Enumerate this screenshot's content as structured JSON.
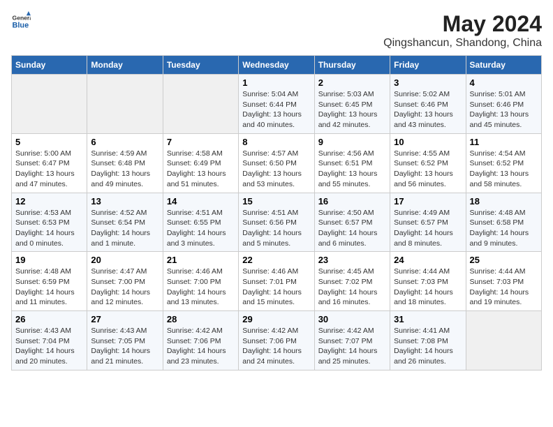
{
  "header": {
    "logo_general": "General",
    "logo_blue": "Blue",
    "title": "May 2024",
    "subtitle": "Qingshancun, Shandong, China"
  },
  "calendar": {
    "days_of_week": [
      "Sunday",
      "Monday",
      "Tuesday",
      "Wednesday",
      "Thursday",
      "Friday",
      "Saturday"
    ],
    "weeks": [
      [
        {
          "day": "",
          "info": ""
        },
        {
          "day": "",
          "info": ""
        },
        {
          "day": "",
          "info": ""
        },
        {
          "day": "1",
          "info": "Sunrise: 5:04 AM\nSunset: 6:44 PM\nDaylight: 13 hours\nand 40 minutes."
        },
        {
          "day": "2",
          "info": "Sunrise: 5:03 AM\nSunset: 6:45 PM\nDaylight: 13 hours\nand 42 minutes."
        },
        {
          "day": "3",
          "info": "Sunrise: 5:02 AM\nSunset: 6:46 PM\nDaylight: 13 hours\nand 43 minutes."
        },
        {
          "day": "4",
          "info": "Sunrise: 5:01 AM\nSunset: 6:46 PM\nDaylight: 13 hours\nand 45 minutes."
        }
      ],
      [
        {
          "day": "5",
          "info": "Sunrise: 5:00 AM\nSunset: 6:47 PM\nDaylight: 13 hours\nand 47 minutes."
        },
        {
          "day": "6",
          "info": "Sunrise: 4:59 AM\nSunset: 6:48 PM\nDaylight: 13 hours\nand 49 minutes."
        },
        {
          "day": "7",
          "info": "Sunrise: 4:58 AM\nSunset: 6:49 PM\nDaylight: 13 hours\nand 51 minutes."
        },
        {
          "day": "8",
          "info": "Sunrise: 4:57 AM\nSunset: 6:50 PM\nDaylight: 13 hours\nand 53 minutes."
        },
        {
          "day": "9",
          "info": "Sunrise: 4:56 AM\nSunset: 6:51 PM\nDaylight: 13 hours\nand 55 minutes."
        },
        {
          "day": "10",
          "info": "Sunrise: 4:55 AM\nSunset: 6:52 PM\nDaylight: 13 hours\nand 56 minutes."
        },
        {
          "day": "11",
          "info": "Sunrise: 4:54 AM\nSunset: 6:52 PM\nDaylight: 13 hours\nand 58 minutes."
        }
      ],
      [
        {
          "day": "12",
          "info": "Sunrise: 4:53 AM\nSunset: 6:53 PM\nDaylight: 14 hours\nand 0 minutes."
        },
        {
          "day": "13",
          "info": "Sunrise: 4:52 AM\nSunset: 6:54 PM\nDaylight: 14 hours\nand 1 minute."
        },
        {
          "day": "14",
          "info": "Sunrise: 4:51 AM\nSunset: 6:55 PM\nDaylight: 14 hours\nand 3 minutes."
        },
        {
          "day": "15",
          "info": "Sunrise: 4:51 AM\nSunset: 6:56 PM\nDaylight: 14 hours\nand 5 minutes."
        },
        {
          "day": "16",
          "info": "Sunrise: 4:50 AM\nSunset: 6:57 PM\nDaylight: 14 hours\nand 6 minutes."
        },
        {
          "day": "17",
          "info": "Sunrise: 4:49 AM\nSunset: 6:57 PM\nDaylight: 14 hours\nand 8 minutes."
        },
        {
          "day": "18",
          "info": "Sunrise: 4:48 AM\nSunset: 6:58 PM\nDaylight: 14 hours\nand 9 minutes."
        }
      ],
      [
        {
          "day": "19",
          "info": "Sunrise: 4:48 AM\nSunset: 6:59 PM\nDaylight: 14 hours\nand 11 minutes."
        },
        {
          "day": "20",
          "info": "Sunrise: 4:47 AM\nSunset: 7:00 PM\nDaylight: 14 hours\nand 12 minutes."
        },
        {
          "day": "21",
          "info": "Sunrise: 4:46 AM\nSunset: 7:00 PM\nDaylight: 14 hours\nand 13 minutes."
        },
        {
          "day": "22",
          "info": "Sunrise: 4:46 AM\nSunset: 7:01 PM\nDaylight: 14 hours\nand 15 minutes."
        },
        {
          "day": "23",
          "info": "Sunrise: 4:45 AM\nSunset: 7:02 PM\nDaylight: 14 hours\nand 16 minutes."
        },
        {
          "day": "24",
          "info": "Sunrise: 4:44 AM\nSunset: 7:03 PM\nDaylight: 14 hours\nand 18 minutes."
        },
        {
          "day": "25",
          "info": "Sunrise: 4:44 AM\nSunset: 7:03 PM\nDaylight: 14 hours\nand 19 minutes."
        }
      ],
      [
        {
          "day": "26",
          "info": "Sunrise: 4:43 AM\nSunset: 7:04 PM\nDaylight: 14 hours\nand 20 minutes."
        },
        {
          "day": "27",
          "info": "Sunrise: 4:43 AM\nSunset: 7:05 PM\nDaylight: 14 hours\nand 21 minutes."
        },
        {
          "day": "28",
          "info": "Sunrise: 4:42 AM\nSunset: 7:06 PM\nDaylight: 14 hours\nand 23 minutes."
        },
        {
          "day": "29",
          "info": "Sunrise: 4:42 AM\nSunset: 7:06 PM\nDaylight: 14 hours\nand 24 minutes."
        },
        {
          "day": "30",
          "info": "Sunrise: 4:42 AM\nSunset: 7:07 PM\nDaylight: 14 hours\nand 25 minutes."
        },
        {
          "day": "31",
          "info": "Sunrise: 4:41 AM\nSunset: 7:08 PM\nDaylight: 14 hours\nand 26 minutes."
        },
        {
          "day": "",
          "info": ""
        }
      ]
    ]
  }
}
